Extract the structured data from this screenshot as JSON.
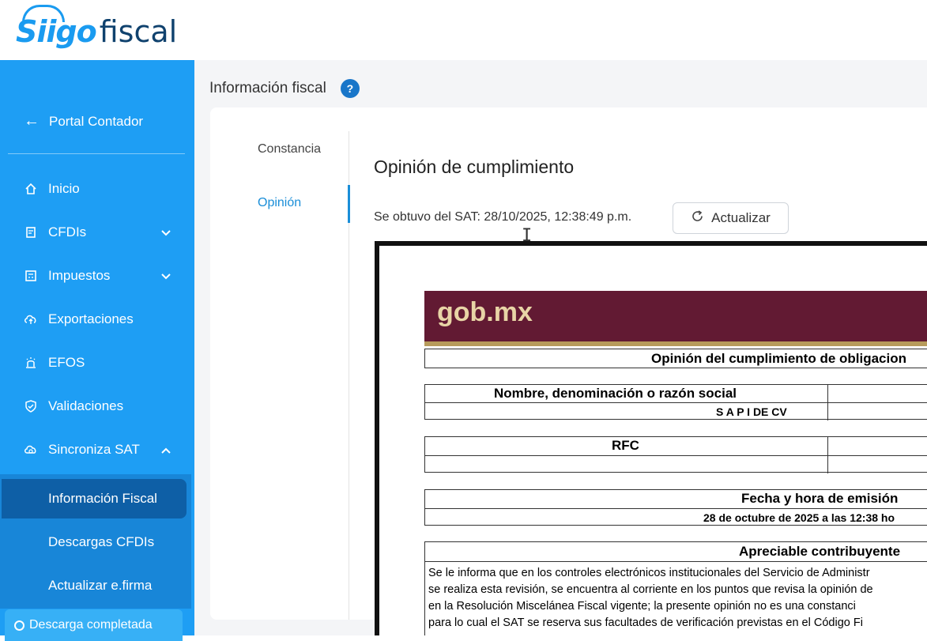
{
  "brand": {
    "logo_siigo": "Siigo",
    "logo_fiscal": "fiscal",
    "accent": "#1e9ef4",
    "dark": "#10426e"
  },
  "sidebar": {
    "back_label": "Portal Contador",
    "items": [
      {
        "label": "Inicio",
        "icon": "home-icon"
      },
      {
        "label": "CFDIs",
        "icon": "document-icon",
        "expandable": true
      },
      {
        "label": "Impuestos",
        "icon": "calculator-icon",
        "expandable": true
      },
      {
        "label": "Exportaciones",
        "icon": "cloud-upload-icon"
      },
      {
        "label": "EFOS",
        "icon": "alarm-icon"
      },
      {
        "label": "Validaciones",
        "icon": "shield-check-icon"
      },
      {
        "label": "Sincroniza SAT",
        "icon": "cloud-sync-icon",
        "expanded": true
      }
    ],
    "subitems": [
      {
        "label": "Información Fiscal",
        "active": true
      },
      {
        "label": "Descargas CFDIs"
      },
      {
        "label": "Actualizar e.firma"
      }
    ],
    "toast": "Descarga completada"
  },
  "main": {
    "title": "Información fiscal",
    "help": "?",
    "tabs": [
      {
        "label": "Constancia"
      },
      {
        "label": "Opinión",
        "active": true
      }
    ],
    "heading": "Opinión de cumplimiento",
    "obtained": "Se obtuvo del SAT: 28/10/2025, 12:38:49 p.m.",
    "refresh_label": "Actualizar"
  },
  "pdf": {
    "logo": "gob.mx",
    "doc_title": "Opinión del cumplimiento de obligacion",
    "name_header": "Nombre, denominación o razón social",
    "name_value": "S A P I DE CV",
    "rfc_header": "RFC",
    "rfc_value": "",
    "date_header": "Fecha y hora de emisión",
    "date_value": "28 de octubre de 2025 a las 12:38 ho",
    "greeting": "Apreciable contribuyente",
    "lines": [
      "Se le informa que en los controles electrónicos institucionales del Servicio de Administr",
      "se realiza esta revisión, se encuentra al corriente en los puntos que revisa la opinión de",
      "en la Resolución Miscelánea Fiscal vigente; la presente opinión no es una constanci",
      "para lo cual el SAT se reserva sus facultades de verificación previstas en el Código Fi"
    ]
  }
}
